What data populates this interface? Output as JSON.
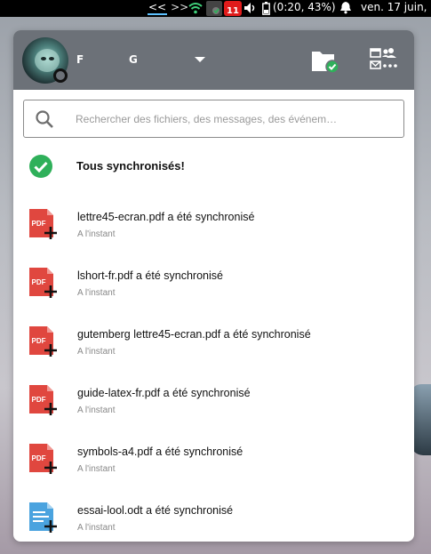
{
  "system_bar": {
    "nav_prev": "<<",
    "nav_next": ">>",
    "notification_badge": "11",
    "battery": "(0:20, 43%)",
    "date": "ven. 17 juin,"
  },
  "header": {
    "user_first": "F",
    "user_last": "G"
  },
  "search": {
    "placeholder": "Rechercher des fichiers, des messages, des événem…"
  },
  "status": {
    "message": "Tous synchronisés!"
  },
  "activities": [
    {
      "title": "lettre45-ecran.pdf a été synchronisé",
      "time": "A l'instant",
      "type": "pdf"
    },
    {
      "title": "lshort-fr.pdf a été synchronisé",
      "time": "A l'instant",
      "type": "pdf"
    },
    {
      "title": "gutemberg lettre45-ecran.pdf a été synchronisé",
      "time": "A l'instant",
      "type": "pdf"
    },
    {
      "title": "guide-latex-fr.pdf a été synchronisé",
      "time": "A l'instant",
      "type": "pdf"
    },
    {
      "title": "symbols-a4.pdf a été synchronisé",
      "time": "A l'instant",
      "type": "pdf"
    },
    {
      "title": "essai-lool.odt a été synchronisé",
      "time": "A l'instant",
      "type": "odt"
    }
  ],
  "icons": {
    "pdf_label": "PDF"
  },
  "colors": {
    "header_bg": "#6c7178",
    "pdf_red": "#e0473f",
    "doc_blue": "#4aa3df",
    "success_green": "#2fb05a"
  }
}
